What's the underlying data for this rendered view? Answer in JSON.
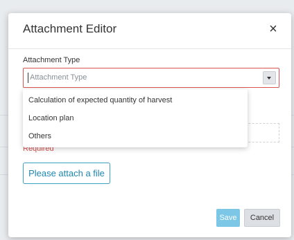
{
  "dialog": {
    "title": "Attachment Editor",
    "close_label": "×"
  },
  "attachment_type": {
    "label": "Attachment Type",
    "placeholder": "Attachment Type",
    "options": [
      "Calculation of expected quantity of harvest",
      "Location plan",
      "Others"
    ]
  },
  "validation": {
    "required_text": "Required"
  },
  "attach_button_label": "Please attach a file",
  "footer": {
    "save_label": "Save",
    "cancel_label": "Cancel"
  },
  "colors": {
    "error": "#d9534f",
    "accent": "#3aa0c2",
    "save_disabled": "#7cc7e6"
  },
  "icons": {
    "close": "close-icon",
    "dropdown": "chevron-down-icon"
  }
}
